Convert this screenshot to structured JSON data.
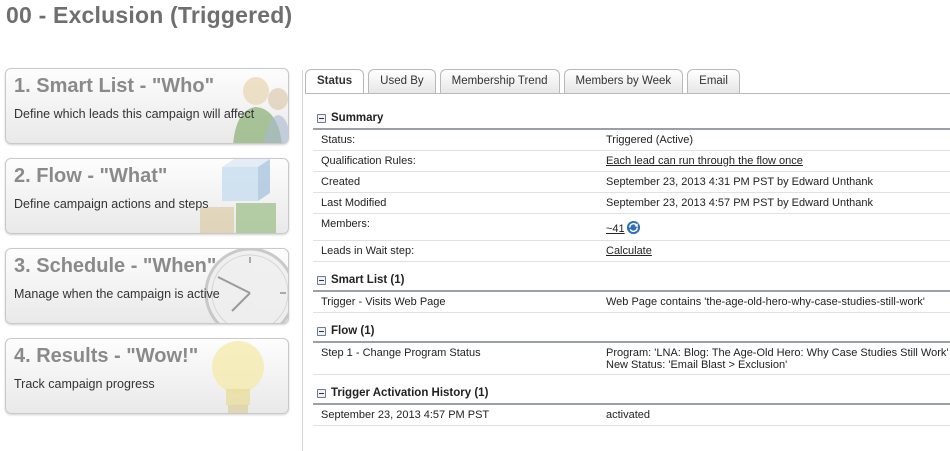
{
  "page_title": "00 - Exclusion (Triggered)",
  "steps": [
    {
      "title": "1. Smart List - \"Who\"",
      "desc": "Define which leads this campaign will affect",
      "icon": "people-icon"
    },
    {
      "title": "2. Flow - \"What\"",
      "desc": "Define campaign actions and steps",
      "icon": "blocks-icon"
    },
    {
      "title": "3. Schedule - \"When\"",
      "desc": "Manage when the campaign is active",
      "icon": "clock-icon"
    },
    {
      "title": "4. Results - \"Wow!\"",
      "desc": "Track campaign progress",
      "icon": "lightbulb-icon"
    }
  ],
  "tabs": [
    "Status",
    "Used By",
    "Membership Trend",
    "Members by Week",
    "Email"
  ],
  "summary": {
    "title": "Summary",
    "status_label": "Status:",
    "status_value": "Triggered (Active)",
    "qual_label": "Qualification Rules:",
    "qual_value": "Each lead can run through the flow once",
    "created_label": "Created",
    "created_value": "September 23, 2013 4:31 PM PST by Edward Unthank",
    "modified_label": "Last Modified",
    "modified_value": "September 23, 2013 4:57 PM PST by Edward Unthank",
    "members_label": "Members:",
    "members_value": "~41",
    "wait_label": "Leads in Wait step:",
    "wait_value": "Calculate"
  },
  "smart_list": {
    "title": "Smart List (1)",
    "trigger_label": "Trigger - Visits Web Page",
    "trigger_value": "Web Page contains 'the-age-old-hero-why-case-studies-still-work'"
  },
  "flow": {
    "title": "Flow (1)",
    "step_label": "Step 1 - Change Program Status",
    "step_value_1": "Program: 'LNA: Blog: The Age-Old Hero: Why Case Studies Still Work'",
    "step_value_2": "New Status: 'Email Blast > Exclusion'"
  },
  "history": {
    "title": "Trigger Activation History (1)",
    "date": "September 23, 2013 4:57 PM PST",
    "action": "activated"
  }
}
